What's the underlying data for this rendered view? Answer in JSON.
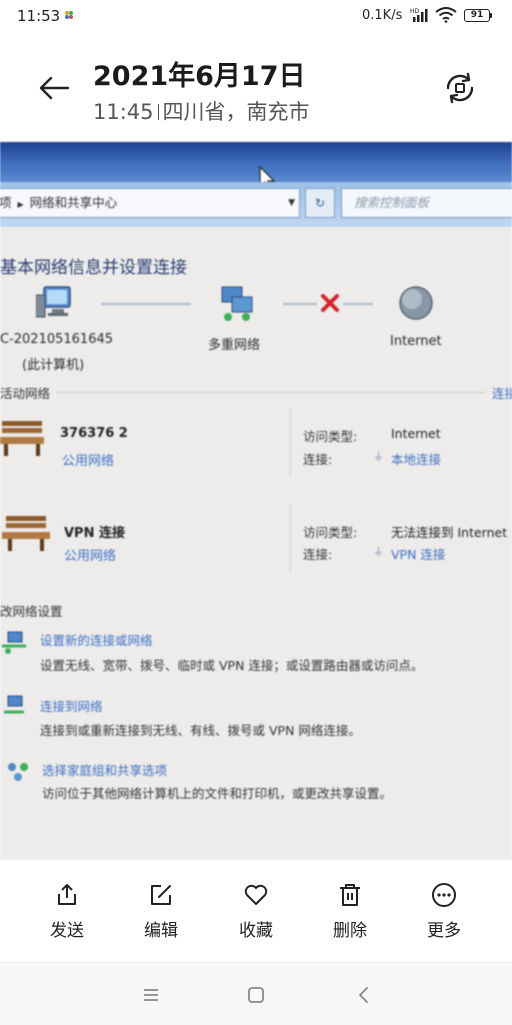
{
  "status_bar": {
    "time": "11:53",
    "net_speed": "0.1K/s",
    "signal_tag": "HD",
    "battery": "91"
  },
  "header": {
    "date": "2021年6月17日",
    "time": "11:45",
    "location": "四川省，南充市"
  },
  "photo": {
    "breadcrumb": [
      "项",
      "网络和共享中心"
    ],
    "search_placeholder": "搜索控制面板",
    "page_title": "基本网络信息并设置连接",
    "map_nodes": [
      "C-202105161645",
      "(此计算机)",
      "多重网络",
      "Internet"
    ],
    "active_networks_label": "活动网络",
    "active_networks_link": "连接",
    "networks": [
      {
        "name": "376376  2",
        "type": "公用网络",
        "access_key": "访问类型:",
        "access_value": "Internet",
        "conn_key": "连接:",
        "conn_value": "本地连接"
      },
      {
        "name": "VPN 连接",
        "type": "公用网络",
        "access_key": "访问类型:",
        "access_value": "无法连接到 Internet",
        "conn_key": "连接:",
        "conn_value": "VPN 连接"
      }
    ],
    "change_settings_label": "改网络设置",
    "tasks": [
      {
        "title": "设置新的连接或网络",
        "desc": "设置无线、宽带、拨号、临时或 VPN 连接；或设置路由器或访问点。"
      },
      {
        "title": "连接到网络",
        "desc": "连接到或重新连接到无线、有线、拨号或 VPN 网络连接。"
      },
      {
        "title": "选择家庭组和共享选项",
        "desc": "访问位于其他网络计算机上的文件和打印机，或更改共享设置。"
      }
    ]
  },
  "actions": [
    {
      "label": "发送",
      "icon": "share-icon"
    },
    {
      "label": "编辑",
      "icon": "edit-icon"
    },
    {
      "label": "收藏",
      "icon": "heart-icon"
    },
    {
      "label": "删除",
      "icon": "trash-icon"
    },
    {
      "label": "更多",
      "icon": "more-icon"
    }
  ],
  "nav_bar": {
    "icons": [
      "menu-icon",
      "home-icon",
      "back-icon"
    ]
  },
  "colors": {
    "accent_link": "#3a6fc4",
    "title_bar": "#2a4f9f",
    "error_x": "#d0262a"
  }
}
